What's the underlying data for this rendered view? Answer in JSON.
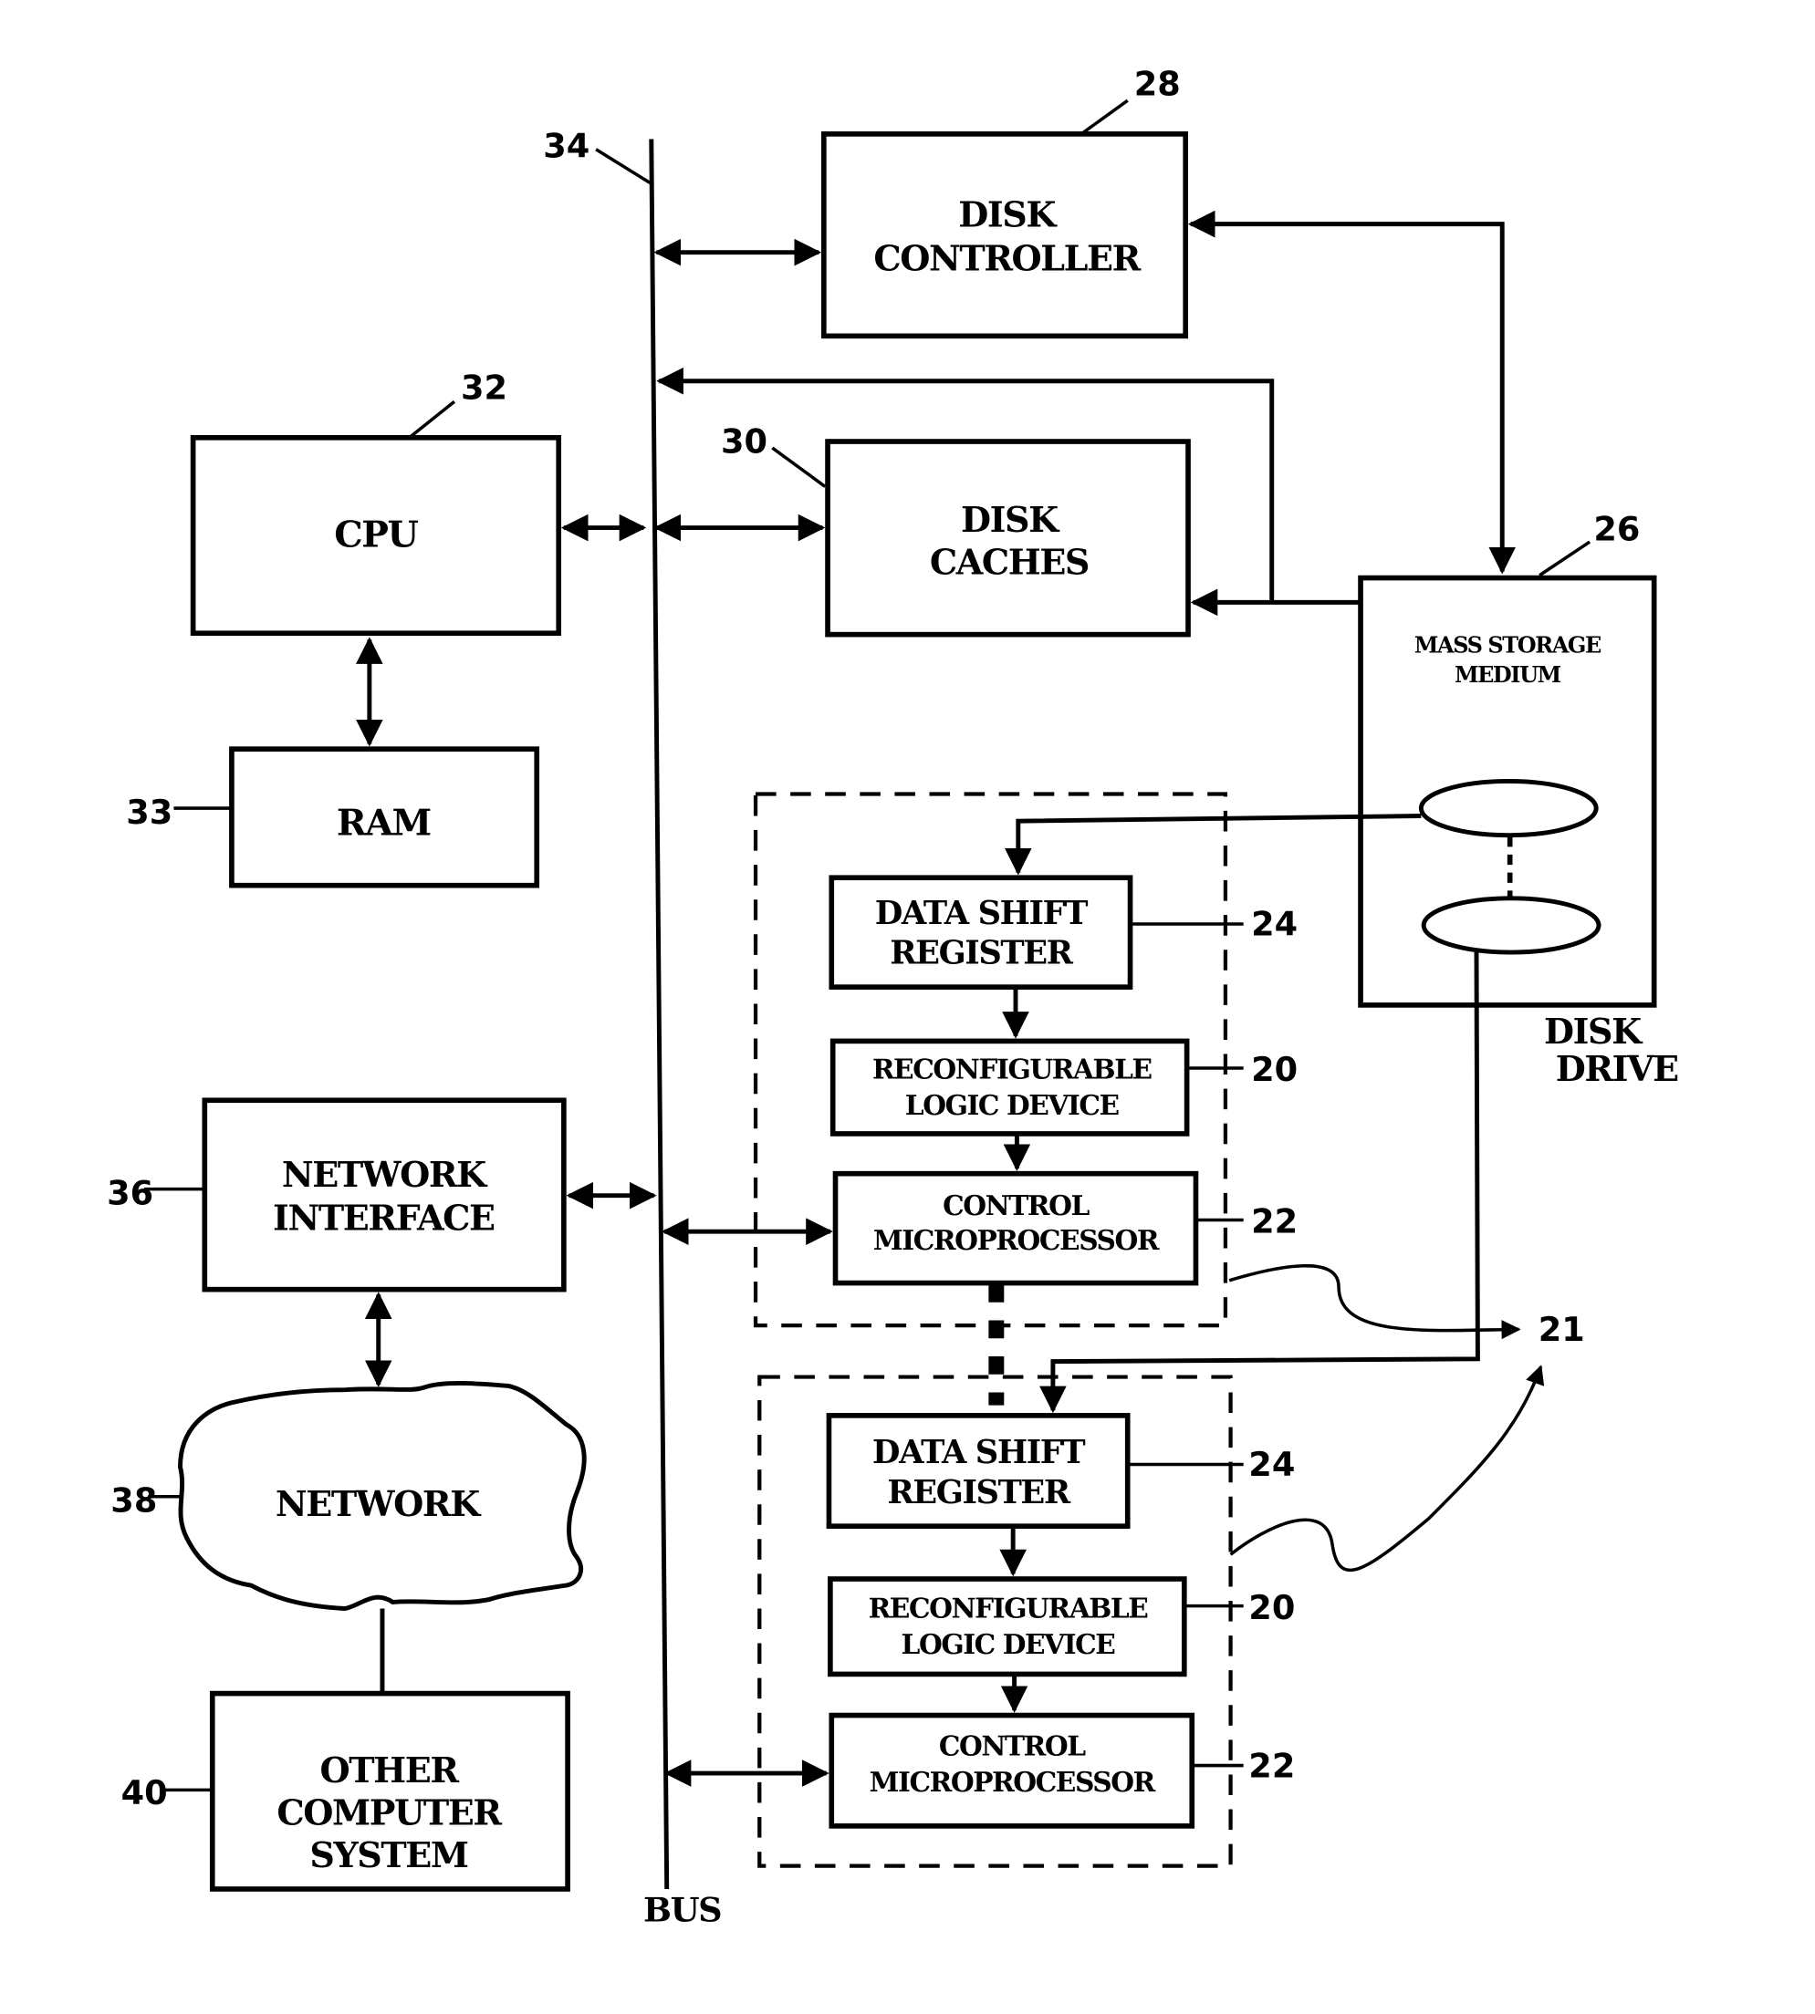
{
  "diagram": {
    "bus": {
      "label": "BUS",
      "ref": "34"
    },
    "disk_controller": {
      "lines": [
        "DISK",
        "CONTROLLER"
      ],
      "ref": "28"
    },
    "disk_caches": {
      "lines": [
        "DISK",
        "CACHES"
      ],
      "ref": "30"
    },
    "cpu": {
      "lines": [
        "CPU"
      ],
      "ref": "32"
    },
    "ram": {
      "lines": [
        "RAM"
      ],
      "ref": "33"
    },
    "mass_storage": {
      "lines": [
        "MASS STORAGE",
        "MEDIUM"
      ],
      "ref": "26"
    },
    "disk_drive": {
      "lines": [
        "DISK",
        "DRIVE"
      ]
    },
    "network_interface": {
      "lines": [
        "NETWORK",
        "INTERFACE"
      ],
      "ref": "36"
    },
    "network": {
      "lines": [
        "NETWORK"
      ],
      "ref": "38"
    },
    "other_computer": {
      "lines": [
        "OTHER",
        "COMPUTER",
        "SYSTEM"
      ],
      "ref": "40"
    },
    "module_ref": "21",
    "modules": [
      {
        "data_shift_register": {
          "lines": [
            "DATA SHIFT",
            "REGISTER"
          ],
          "ref": "24"
        },
        "reconfigurable_logic": {
          "lines": [
            "RECONFIGURABLE",
            "LOGIC DEVICE"
          ],
          "ref": "20"
        },
        "control_microprocessor": {
          "lines": [
            "CONTROL",
            "MICROPROCESSOR"
          ],
          "ref": "22"
        }
      },
      {
        "data_shift_register": {
          "lines": [
            "DATA SHIFT",
            "REGISTER"
          ],
          "ref": "24"
        },
        "reconfigurable_logic": {
          "lines": [
            "RECONFIGURABLE",
            "LOGIC DEVICE"
          ],
          "ref": "20"
        },
        "control_microprocessor": {
          "lines": [
            "CONTROL",
            "MICROPROCESSOR"
          ],
          "ref": "22"
        }
      }
    ]
  }
}
